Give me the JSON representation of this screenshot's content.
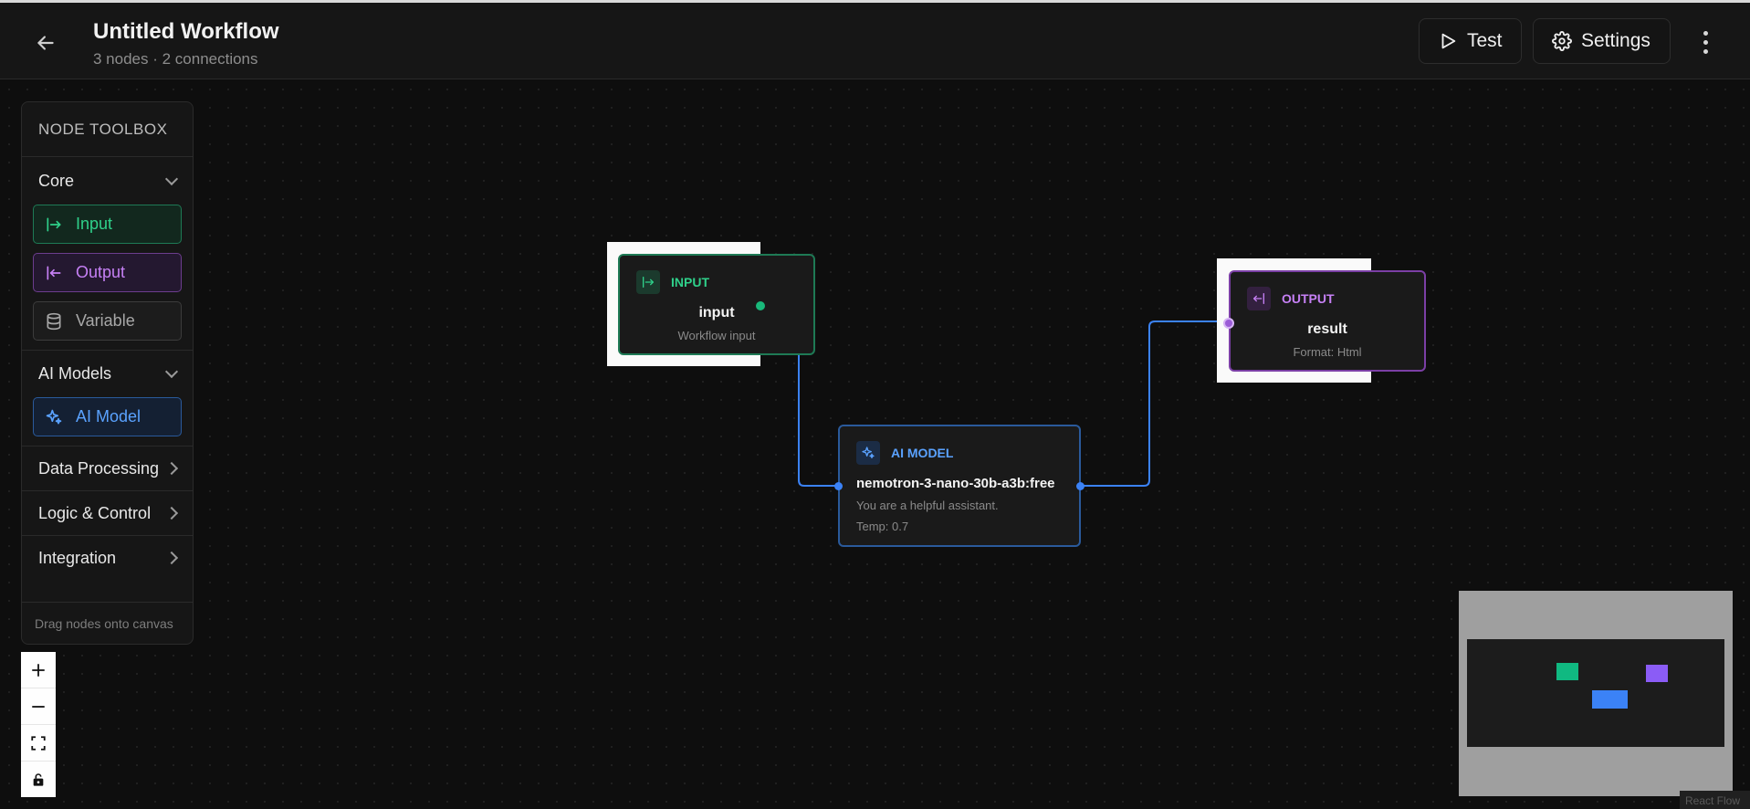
{
  "header": {
    "title": "Untitled Workflow",
    "subtitle": "3 nodes · 2 connections",
    "test_label": "Test",
    "settings_label": "Settings"
  },
  "toolbox": {
    "title": "NODE TOOLBOX",
    "sections": {
      "core": "Core",
      "ai_models": "AI Models",
      "data_processing": "Data Processing",
      "logic_control": "Logic & Control",
      "integration": "Integration"
    },
    "tools": {
      "input": "Input",
      "output": "Output",
      "variable": "Variable",
      "ai_model": "AI Model"
    },
    "footer": "Drag nodes onto canvas"
  },
  "nodes": {
    "input": {
      "type_label": "INPUT",
      "name": "input",
      "desc": "Workflow input"
    },
    "ai_model": {
      "type_label": "AI MODEL",
      "name": "nemotron-3-nano-30b-a3b:free",
      "desc": "You are a helpful assistant.",
      "temp": "Temp: 0.7"
    },
    "output": {
      "type_label": "OUTPUT",
      "name": "result",
      "desc": "Format: Html"
    }
  },
  "watermark": "React Flow",
  "colors": {
    "input": "#2fd08a",
    "output": "#c680f5",
    "ai_model": "#5aa2ff",
    "edge": "#3b82f6"
  }
}
